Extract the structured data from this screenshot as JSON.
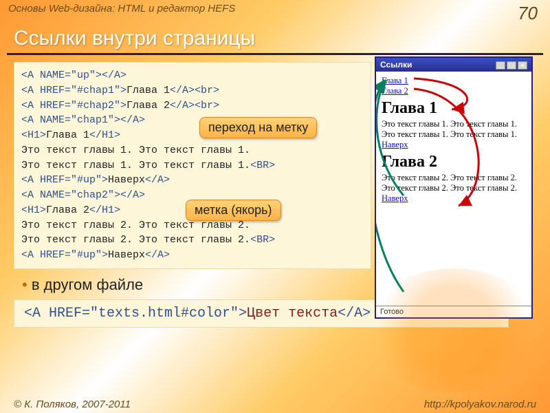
{
  "header": {
    "breadcrumb": "Основы Web-дизайна: HTML и редактор HEFS",
    "slide_number": "70"
  },
  "title": "Ссылки внутри страницы",
  "callouts": {
    "c1": "переход на метку",
    "c2": "метка (якорь)"
  },
  "code": {
    "l1a": "<A NAME=\"up\">",
    "l1b": "</A>",
    "l2a": "<A HREF=\"#chap1\">",
    "l2t": "Глава 1",
    "l2b": "</A><br>",
    "l3a": "<A HREF=\"#chap2\">",
    "l3t": "Глава 2",
    "l3b": "</A><br>",
    "l4a": "<A NAME=\"chap1\">",
    "l4b": "</A>",
    "l5a": "<H1>",
    "l5t": "Глава 1",
    "l5b": "</H1>",
    "l6": "Это текст главы 1. Это текст главы 1.",
    "l7": "Это текст главы 1. Это текст главы 1.",
    "l7b": "<BR>",
    "l8a": "<A HREF=\"#up\">",
    "l8t": "Наверх",
    "l8b": "</A>",
    "l9a": "<A NAME=\"chap2\">",
    "l9b": "</A>",
    "l10a": "<H1>",
    "l10t": "Глава 2",
    "l10b": "</H1>",
    "l11": "Это текст главы 2. Это текст главы 2.",
    "l12": "Это текст главы 2. Это текст главы 2.",
    "l12b": "<BR>",
    "l13a": "<A HREF=\"#up\">",
    "l13t": "Наверх",
    "l13b": "</A>"
  },
  "preview": {
    "win_title": "Ссылки",
    "link1": "Глава 1",
    "link2": "Глава 2",
    "h1": "Глава 1",
    "p1": "Это текст главы 1. Это текст главы 1. Это текст главы 1. Это текст главы 1.",
    "up1": "Наверх",
    "h2": "Глава 2",
    "p2": "Это текст главы 2. Это текст главы 2. Это текст главы 2. Это текст главы 2.",
    "up2": "Наверх",
    "status": "Готово"
  },
  "bullet": "в другом файле",
  "inline_code": {
    "open": " <A HREF=\"texts.html#color\">",
    "text": "Цвет текста",
    "close": "</A> "
  },
  "footer": {
    "left": "© К. Поляков, 2007-2011",
    "right": "http://kpolyakov.narod.ru"
  }
}
